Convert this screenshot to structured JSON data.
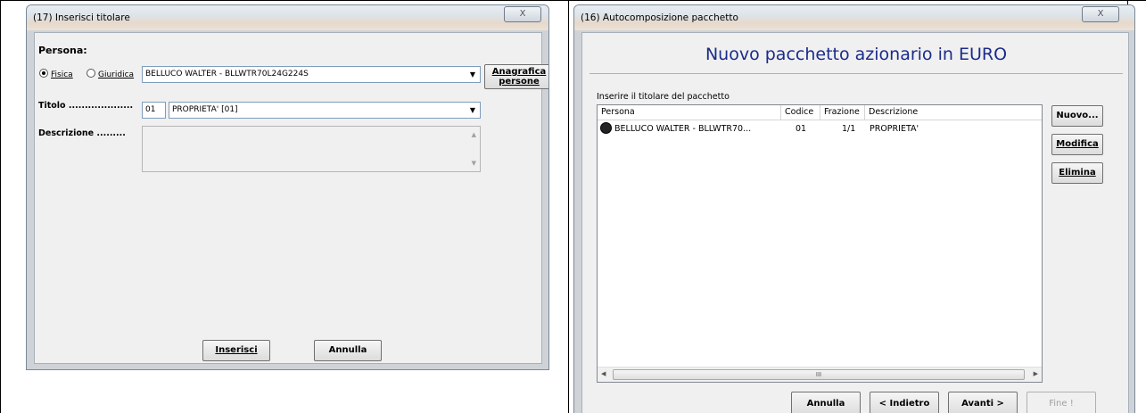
{
  "left_window": {
    "title": "(17) Inserisci titolare",
    "close_label": "X",
    "persona_label": "Persona:",
    "radio_fisica": "Fisica",
    "radio_giuridica": "Giuridica",
    "persona_value": "BELLUCO WALTER - BLLWTR70L24G224S",
    "anagrafica_btn_line1": "Anagrafica",
    "anagrafica_btn_line2": "persone",
    "titolo_label": "Titolo ....................",
    "titolo_code": "01",
    "titolo_value": "PROPRIETA' [01]",
    "descrizione_label": "Descrizione .........",
    "descrizione_value": "",
    "inserisci_btn": "Inserisci",
    "annulla_btn": "Annulla"
  },
  "right_window": {
    "title": "(16) Autocomposizione pacchetto",
    "close_label": "X",
    "heading": "Nuovo pacchetto azionario in EURO",
    "list_caption": "Inserire il titolare del pacchetto",
    "columns": [
      "Persona",
      "Codice",
      "Frazione",
      "Descrizione"
    ],
    "rows": [
      {
        "persona": "BELLUCO WALTER - BLLWTR70...",
        "codice": "01",
        "frazione": "1/1",
        "descrizione": "PROPRIETA'"
      }
    ],
    "scroll_thumb": "III",
    "nuovo_btn": "Nuovo...",
    "modifica_btn": "Modifica",
    "elimina_btn": "Elimina",
    "annulla_btn": "Annulla",
    "indietro_btn": "< Indietro",
    "avanti_btn": "Avanti >",
    "fine_btn": "Fine !"
  }
}
